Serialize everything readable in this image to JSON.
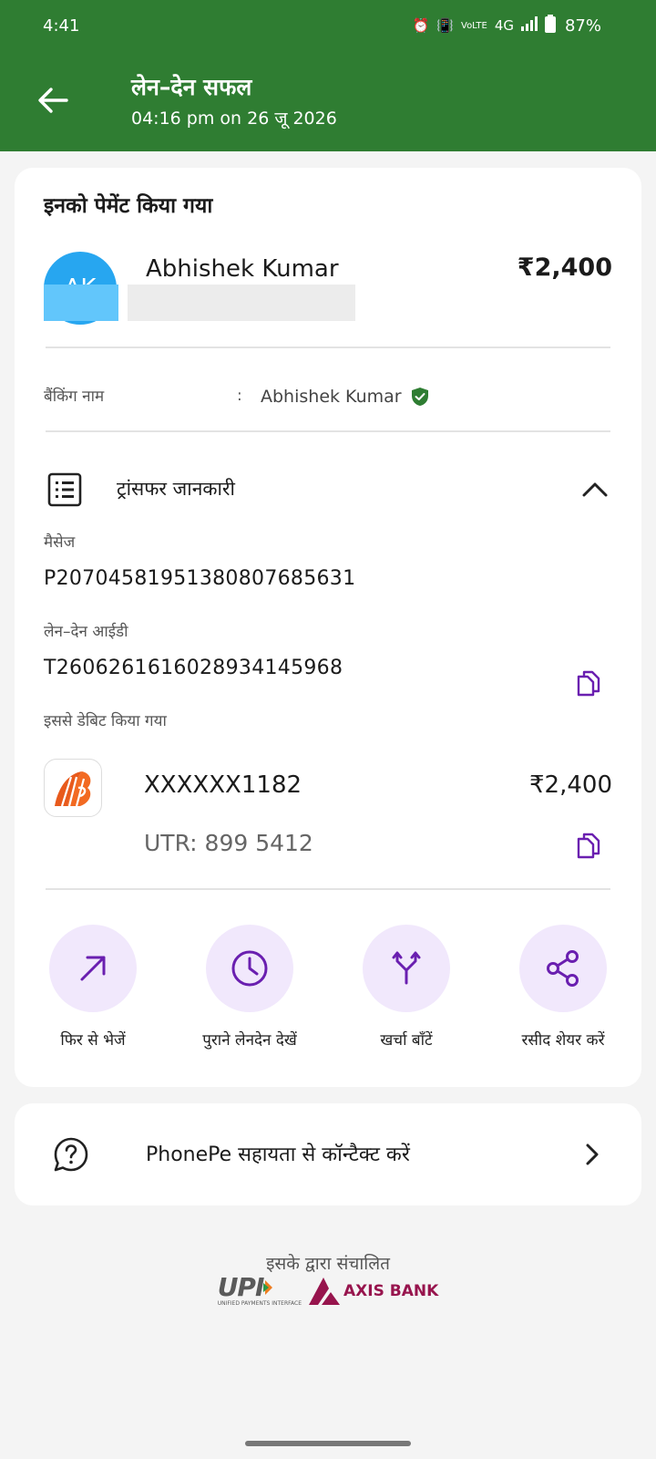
{
  "status_bar": {
    "time": "4:41",
    "network": "4G",
    "volte": "VoLTE",
    "battery": "87%"
  },
  "header": {
    "title": "लेन–देन सफल",
    "subtitle": "04:16 pm on 26 जू  2026",
    "bg_color": "#2f7d32"
  },
  "paid_to": {
    "title": "इनको पेमेंट किया गया",
    "avatar_initials": "AK",
    "name": "Abhishek Kumar",
    "amount": "₹2,400"
  },
  "banking_name": {
    "label": "बैंकिंग नाम",
    "colon": ":",
    "value": "Abhishek Kumar"
  },
  "transfer": {
    "title": "ट्रांसफर जानकारी",
    "message_label": "मैसेज",
    "message_value": "P2070458195138080768563​1",
    "txn_id_label": "लेन–देन आईडी",
    "txn_id_value": "T2606261616028934145968",
    "debited_label": "इससे डेबिट किया गया",
    "account": "XXXXXX1182",
    "debit_amount": "₹2,400",
    "utr": "UTR: 899        5412"
  },
  "actions": [
    {
      "label": "फिर से भेजें",
      "icon": "arrow-up-right-icon"
    },
    {
      "label": "पुराने लेनदेन देखें",
      "icon": "clock-icon"
    },
    {
      "label": "खर्चा बाँटें",
      "icon": "split-icon"
    },
    {
      "label": "रसीद शेयर करें",
      "icon": "share-icon"
    }
  ],
  "help": {
    "text": "PhonePe सहायता से कॉन्टैक्ट करें"
  },
  "footer": {
    "powered_by": "इसके द्वारा संचालित",
    "upi_text": "UPI",
    "upi_sub": "UNIFIED PAYMENTS INTERFACE",
    "axis_text": "AXIS BANK"
  },
  "colors": {
    "accent_purple": "#6a1fb0",
    "action_bg": "#f1e8fc",
    "verified_green": "#2e7d32"
  }
}
